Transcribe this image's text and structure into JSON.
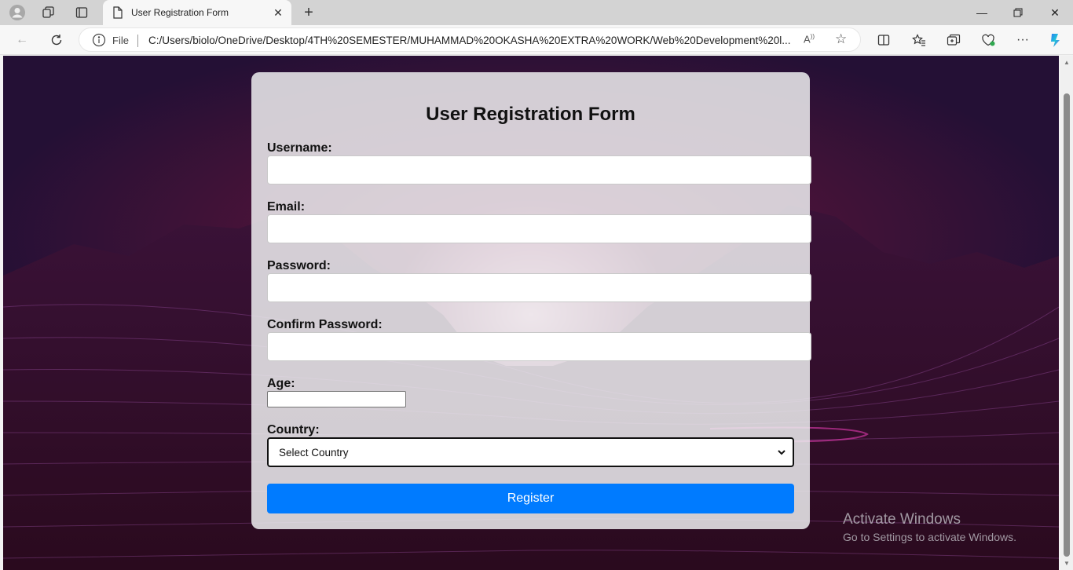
{
  "browser": {
    "tab_title": "User Registration Form",
    "address_prefix": "File",
    "url": "C:/Users/biolo/OneDrive/Desktop/4TH%20SEMESTER/MUHAMMAD%20OKASHA%20EXTRA%20WORK/Web%20Development%20l..."
  },
  "form": {
    "title": "User Registration Form",
    "fields": {
      "username_label": "Username:",
      "email_label": "Email:",
      "password_label": "Password:",
      "confirm_password_label": "Confirm Password:",
      "age_label": "Age:",
      "country_label": "Country:",
      "country_selected": "Select Country"
    },
    "register_label": "Register"
  },
  "watermark": {
    "title": "Activate Windows",
    "subtitle": "Go to Settings to activate Windows."
  },
  "colors": {
    "accent": "#007bff",
    "tabstrip": "#d3d3d3"
  }
}
